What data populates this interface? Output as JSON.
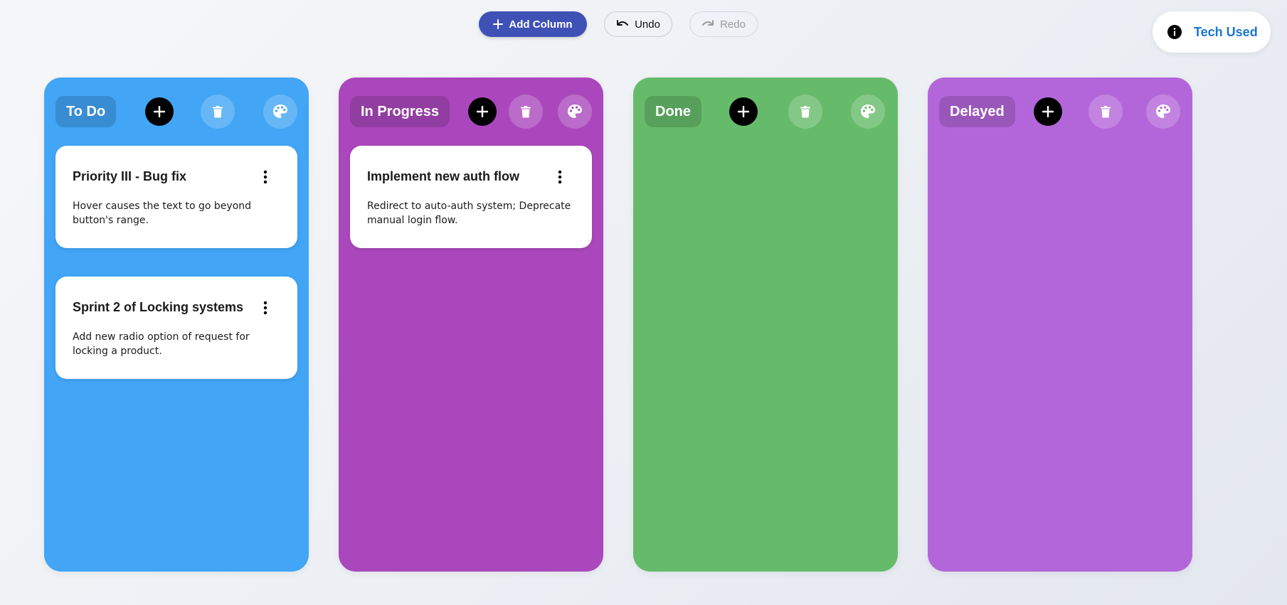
{
  "toolbar": {
    "add_column_label": "Add Column",
    "undo_label": "Undo",
    "redo_label": "Redo"
  },
  "tech_used": {
    "label": "Tech Used",
    "icon": "info-icon"
  },
  "colors": {
    "accent": "#3f51b5",
    "link": "#1976d2",
    "todo": "#42a5f5",
    "in_progress": "#ab47bc",
    "done": "#66bb6a",
    "delayed": "#b366d9"
  },
  "columns": [
    {
      "title": "To Do",
      "cards": [
        {
          "title": "Priority III - Bug fix",
          "description": "Hover causes the text to go beyond button's range."
        },
        {
          "title": "Sprint 2 of Locking systems",
          "description": "Add new radio option of request for locking a product."
        }
      ]
    },
    {
      "title": "In Progress",
      "cards": [
        {
          "title": "Implement new auth flow",
          "description": "Redirect to auto-auth system; Deprecate manual login flow."
        }
      ]
    },
    {
      "title": "Done",
      "cards": []
    },
    {
      "title": "Delayed",
      "cards": []
    }
  ]
}
